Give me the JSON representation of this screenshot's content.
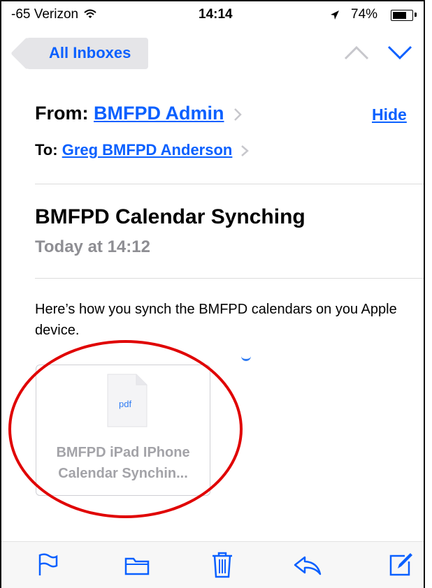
{
  "status_bar": {
    "carrier": "-65 Verizon",
    "time": "14:14",
    "battery": "74%"
  },
  "nav": {
    "back_label": "All Inboxes"
  },
  "header": {
    "from_label": "From:",
    "from_name": "BMFPD Admin",
    "hide_label": "Hide",
    "to_label": "To:",
    "to_name": "Greg BMFPD Anderson"
  },
  "message": {
    "subject": "BMFPD Calendar Synching",
    "date": "Today at 14:12",
    "body": "Here’s how you synch the BMFPD calendars on you Apple device."
  },
  "attachment": {
    "type_label": "pdf",
    "name_line1": "BMFPD iPad IPhone",
    "name_line2": "Calendar Synchin..."
  },
  "colors": {
    "accent": "#0a60ff",
    "annotation": "#e00000",
    "secondary_text": "#8e8e93"
  },
  "toolbar": {
    "icons": [
      "flag-icon",
      "folder-icon",
      "trash-icon",
      "reply-icon",
      "compose-icon"
    ]
  }
}
